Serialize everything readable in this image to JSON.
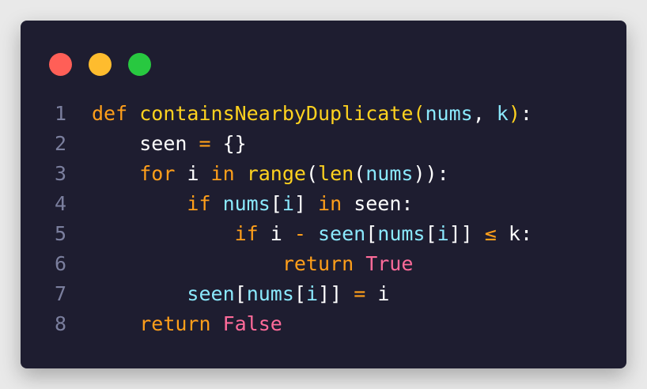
{
  "window": {
    "buttons": [
      {
        "name": "close",
        "color": "#ff5f57"
      },
      {
        "name": "minimize",
        "color": "#febc2e"
      },
      {
        "name": "zoom",
        "color": "#28c840"
      }
    ]
  },
  "theme": {
    "keyword": "#ff9f1a",
    "function": "#ffd21f",
    "param": "#8be9fd",
    "plain": "#ffffff",
    "constant": "#ff6b9a",
    "gutter": "#7b7f9e"
  },
  "lines": [
    {
      "num": "1",
      "tokens": [
        {
          "t": "def ",
          "c": "keyword"
        },
        {
          "t": "containsNearbyDuplicate",
          "c": "function"
        },
        {
          "t": "(",
          "c": "function"
        },
        {
          "t": "nums",
          "c": "param"
        },
        {
          "t": ", ",
          "c": "plain"
        },
        {
          "t": "k",
          "c": "param"
        },
        {
          "t": ")",
          "c": "function"
        },
        {
          "t": ":",
          "c": "plain"
        }
      ]
    },
    {
      "num": "2",
      "tokens": [
        {
          "t": "    ",
          "c": "plain"
        },
        {
          "t": "seen ",
          "c": "plain"
        },
        {
          "t": "= ",
          "c": "keyword"
        },
        {
          "t": "{}",
          "c": "plain"
        }
      ]
    },
    {
      "num": "3",
      "tokens": [
        {
          "t": "    ",
          "c": "plain"
        },
        {
          "t": "for ",
          "c": "keyword"
        },
        {
          "t": "i ",
          "c": "plain"
        },
        {
          "t": "in ",
          "c": "keyword"
        },
        {
          "t": "range",
          "c": "function"
        },
        {
          "t": "(",
          "c": "plain"
        },
        {
          "t": "len",
          "c": "function"
        },
        {
          "t": "(",
          "c": "plain"
        },
        {
          "t": "nums",
          "c": "param"
        },
        {
          "t": ")):",
          "c": "plain"
        }
      ]
    },
    {
      "num": "4",
      "tokens": [
        {
          "t": "        ",
          "c": "plain"
        },
        {
          "t": "if ",
          "c": "keyword"
        },
        {
          "t": "nums",
          "c": "param"
        },
        {
          "t": "[",
          "c": "plain"
        },
        {
          "t": "i",
          "c": "param"
        },
        {
          "t": "] ",
          "c": "plain"
        },
        {
          "t": "in ",
          "c": "keyword"
        },
        {
          "t": "seen:",
          "c": "plain"
        }
      ]
    },
    {
      "num": "5",
      "tokens": [
        {
          "t": "            ",
          "c": "plain"
        },
        {
          "t": "if ",
          "c": "keyword"
        },
        {
          "t": "i ",
          "c": "plain"
        },
        {
          "t": "- ",
          "c": "keyword"
        },
        {
          "t": "seen",
          "c": "param"
        },
        {
          "t": "[",
          "c": "plain"
        },
        {
          "t": "nums",
          "c": "param"
        },
        {
          "t": "[",
          "c": "plain"
        },
        {
          "t": "i",
          "c": "param"
        },
        {
          "t": "]] ",
          "c": "plain"
        },
        {
          "t": "≤ ",
          "c": "keyword"
        },
        {
          "t": "k:",
          "c": "plain"
        }
      ]
    },
    {
      "num": "6",
      "tokens": [
        {
          "t": "                ",
          "c": "plain"
        },
        {
          "t": "return ",
          "c": "keyword"
        },
        {
          "t": "True",
          "c": "constant"
        }
      ]
    },
    {
      "num": "7",
      "tokens": [
        {
          "t": "        ",
          "c": "plain"
        },
        {
          "t": "seen",
          "c": "param"
        },
        {
          "t": "[",
          "c": "plain"
        },
        {
          "t": "nums",
          "c": "param"
        },
        {
          "t": "[",
          "c": "plain"
        },
        {
          "t": "i",
          "c": "param"
        },
        {
          "t": "]] ",
          "c": "plain"
        },
        {
          "t": "= ",
          "c": "keyword"
        },
        {
          "t": "i",
          "c": "plain"
        }
      ]
    },
    {
      "num": "8",
      "tokens": [
        {
          "t": "    ",
          "c": "plain"
        },
        {
          "t": "return ",
          "c": "keyword"
        },
        {
          "t": "False",
          "c": "constant"
        }
      ]
    }
  ]
}
